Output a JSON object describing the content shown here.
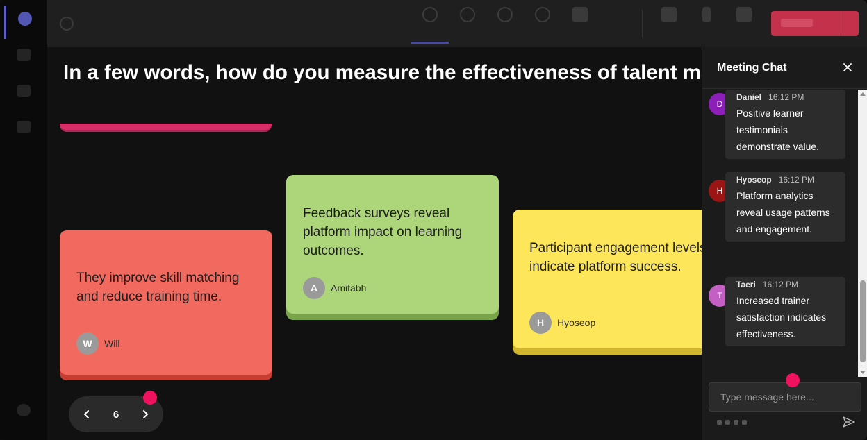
{
  "question": "In a few words, how do you measure the effectiveness of talent marketplace platforms in your training programs?",
  "notes": [
    {
      "text": "They improve skill matching and reduce training time.",
      "initial": "W",
      "author": "Will",
      "color": "#f26a5f"
    },
    {
      "text": "Feedback surveys reveal platform impact on learning outcomes.",
      "initial": "A",
      "author": "Amitabh",
      "color": "#add67a"
    },
    {
      "text": "Participant engagement levels indicate platform success.",
      "initial": "H",
      "author": "Hyoseop",
      "color": "#fde659"
    }
  ],
  "pager": {
    "page": "6"
  },
  "chat": {
    "title": "Meeting Chat",
    "messages": [
      {
        "initial": "D",
        "avatar_color": "#8b1fb8",
        "name": "Daniel",
        "time": "16:12 PM",
        "text": "Positive learner testimonials demonstrate value."
      },
      {
        "initial": "H",
        "avatar_color": "#9b1515",
        "name": "Hyoseop",
        "time": "16:12 PM",
        "text": "Platform analytics reveal usage patterns and engagement."
      },
      {
        "initial": "T",
        "avatar_color": "#c460c4",
        "name": "Taeri",
        "time": "16:12 PM",
        "text": "Increased trainer satisfaction indicates effectiveness."
      }
    ],
    "input_placeholder": "Type message here..."
  },
  "colors": {
    "accent": "#5b5fc7",
    "leave": "#c4314b",
    "marker": "#f0115f"
  }
}
